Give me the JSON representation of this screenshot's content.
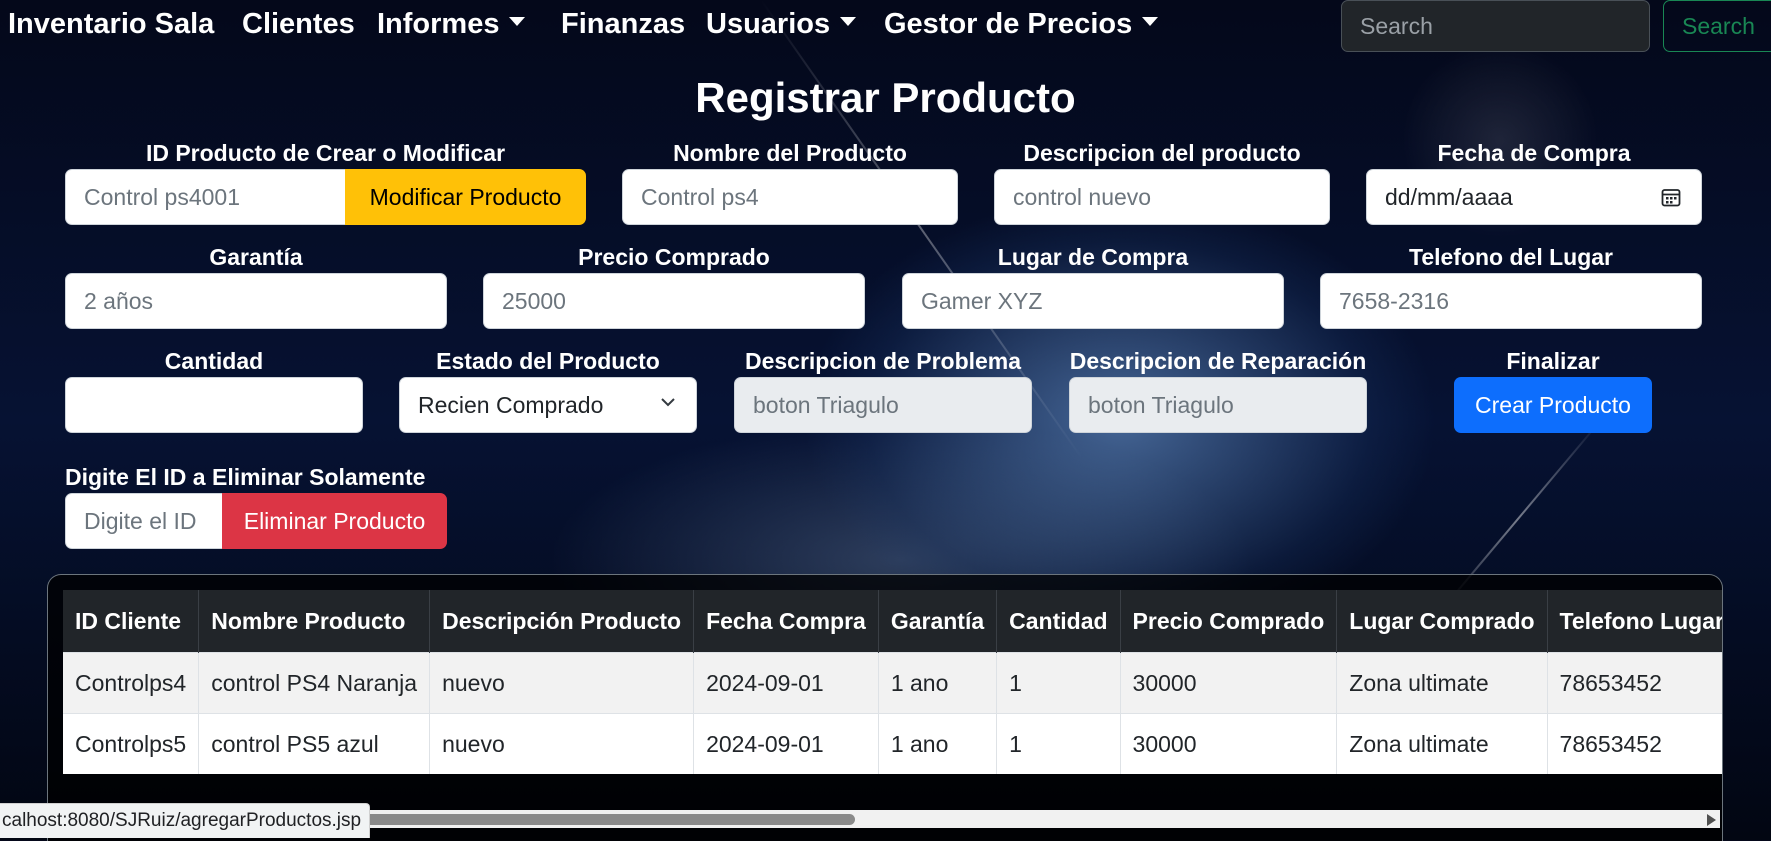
{
  "nav": {
    "items": [
      {
        "label": "Inventario Sala",
        "dropdown": false
      },
      {
        "label": "Clientes",
        "dropdown": false
      },
      {
        "label": "Informes",
        "dropdown": true
      },
      {
        "label": "Finanzas",
        "dropdown": false
      },
      {
        "label": "Usuarios",
        "dropdown": true
      },
      {
        "label": "Gestor de Precios",
        "dropdown": true
      }
    ],
    "search_placeholder": "Search",
    "search_button": "Search"
  },
  "page_title": "Registrar Producto",
  "form": {
    "id_producto": {
      "label": "ID Producto de Crear o Modificar",
      "placeholder": "Control ps4001",
      "button": "Modificar Producto"
    },
    "nombre": {
      "label": "Nombre del Producto",
      "placeholder": "Control ps4"
    },
    "descripcion": {
      "label": "Descripcion del producto",
      "placeholder": "control nuevo"
    },
    "fecha": {
      "label": "Fecha de Compra",
      "placeholder": "dd/mm/aaaa"
    },
    "garantia": {
      "label": "Garantía",
      "placeholder": "2 años"
    },
    "precio": {
      "label": "Precio Comprado",
      "placeholder": "25000"
    },
    "lugar": {
      "label": "Lugar de Compra",
      "placeholder": "Gamer XYZ"
    },
    "telefono": {
      "label": "Telefono del Lugar",
      "placeholder": "7658-2316"
    },
    "cantidad": {
      "label": "Cantidad",
      "value": ""
    },
    "estado": {
      "label": "Estado del Producto",
      "selected": "Recien Comprado"
    },
    "problema": {
      "label": "Descripcion de Problema",
      "placeholder": "boton Triagulo"
    },
    "reparacion": {
      "label": "Descripcion de Reparación",
      "placeholder": "boton Triagulo"
    },
    "finalizar": {
      "label": "Finalizar",
      "button": "Crear Producto"
    },
    "eliminar": {
      "label": "Digite El ID a Eliminar Solamente",
      "placeholder": "Digite el ID",
      "button": "Eliminar Producto"
    }
  },
  "table": {
    "headers": [
      "ID Cliente",
      "Nombre Producto",
      "Descripción Producto",
      "Fecha Compra",
      "Garantía",
      "Cantidad",
      "Precio Comprado",
      "Lugar Comprado",
      "Telefono Lugar"
    ],
    "rows": [
      [
        "Controlps4",
        "control PS4 Naranja",
        "nuevo",
        "2024-09-01",
        "1 ano",
        "1",
        "30000",
        "Zona ultimate",
        "78653452"
      ],
      [
        "Controlps5",
        "control PS5 azul",
        "nuevo",
        "2024-09-01",
        "1 ano",
        "1",
        "30000",
        "Zona ultimate",
        "78653452"
      ]
    ]
  },
  "status_bar": {
    "url": "calhost:8080/SJRuiz/agregarProductos.jsp"
  },
  "colors": {
    "warning": "#ffc107",
    "danger": "#dc3545",
    "primary": "#0d6efd",
    "success": "#198754"
  }
}
